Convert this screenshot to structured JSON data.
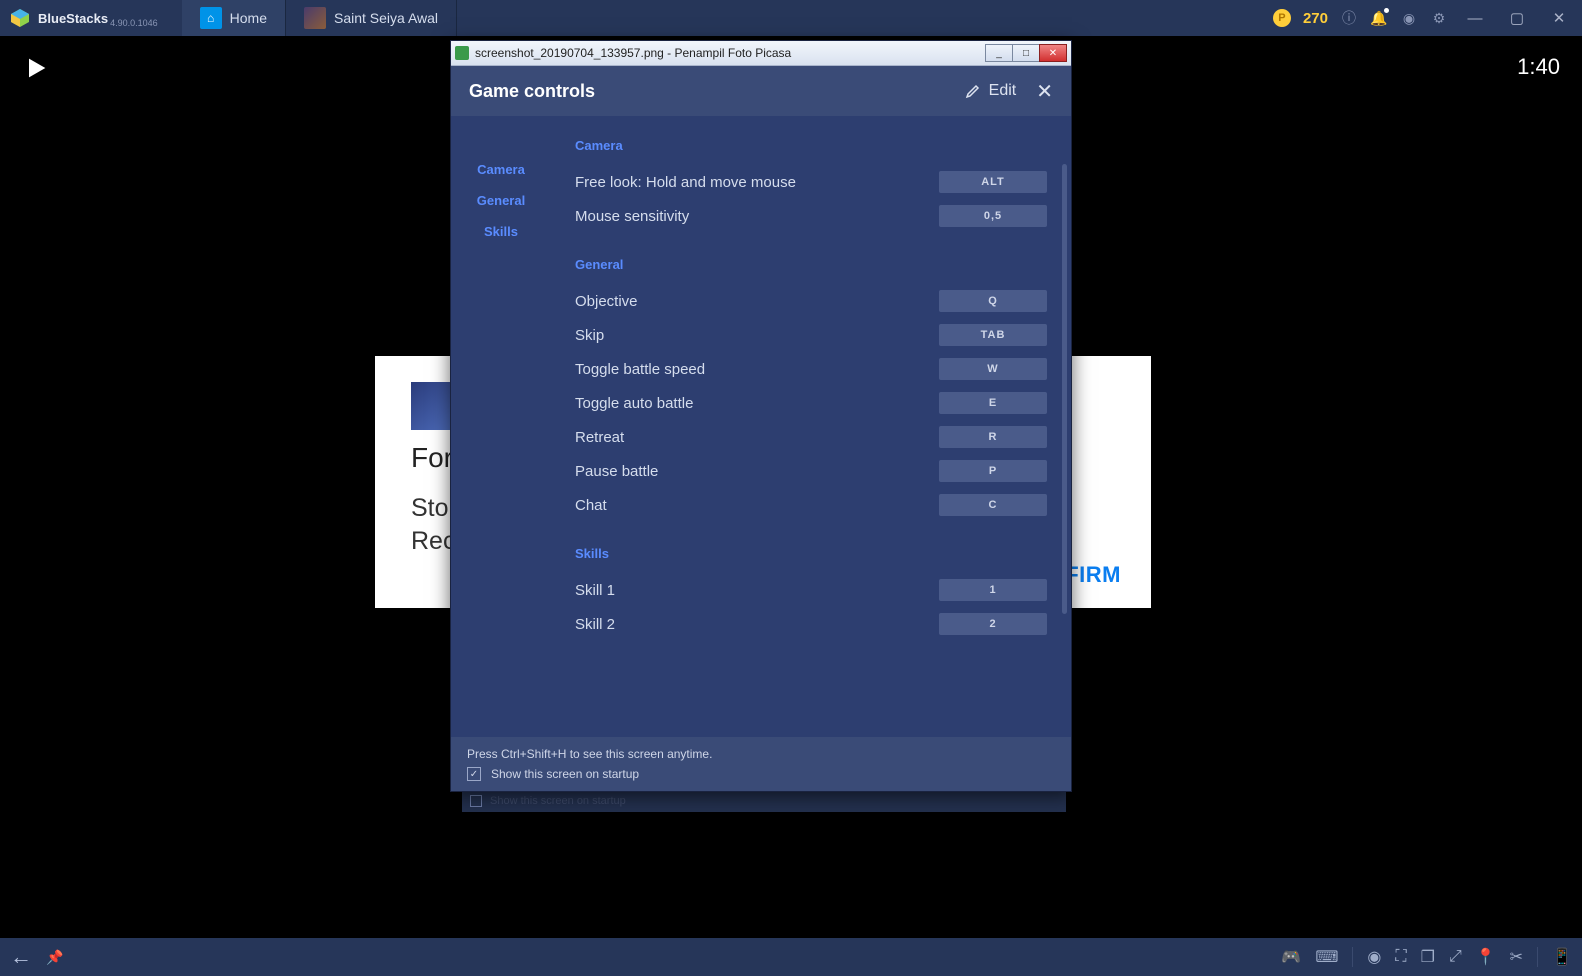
{
  "titlebar": {
    "app_name": "BlueStacks",
    "version": "4.90.0.1046",
    "coin_count": "270"
  },
  "tabs": {
    "home": "Home",
    "game": "Saint Seiya   Awal"
  },
  "clock": "1:40",
  "card": {
    "heading": "For",
    "line1": "Sto",
    "line2": "Rec",
    "firm": "FIRM"
  },
  "ghost": {
    "text": "Show this screen on startup"
  },
  "picasa": {
    "title": "screenshot_20190704_133957.png - Penampil Foto Picasa"
  },
  "game_controls": {
    "title": "Game controls",
    "edit": "Edit",
    "sidebar": [
      "Camera",
      "General",
      "Skills"
    ],
    "sections": {
      "camera": {
        "title": "Camera",
        "rows": [
          {
            "label": "Free look: Hold and move mouse",
            "key": "ALT"
          },
          {
            "label": "Mouse sensitivity",
            "key": "0,5"
          }
        ]
      },
      "general": {
        "title": "General",
        "rows": [
          {
            "label": "Objective",
            "key": "Q"
          },
          {
            "label": "Skip",
            "key": "TAB"
          },
          {
            "label": "Toggle battle speed",
            "key": "W"
          },
          {
            "label": "Toggle auto battle",
            "key": "E"
          },
          {
            "label": "Retreat",
            "key": "R"
          },
          {
            "label": "Pause battle",
            "key": "P"
          },
          {
            "label": "Chat",
            "key": "C"
          }
        ]
      },
      "skills": {
        "title": "Skills",
        "rows": [
          {
            "label": "Skill 1",
            "key": "1"
          },
          {
            "label": "Skill 2",
            "key": "2"
          }
        ]
      }
    },
    "footer": {
      "hint": "Press Ctrl+Shift+H to see this screen anytime.",
      "checkbox": "Show this screen on startup"
    }
  }
}
